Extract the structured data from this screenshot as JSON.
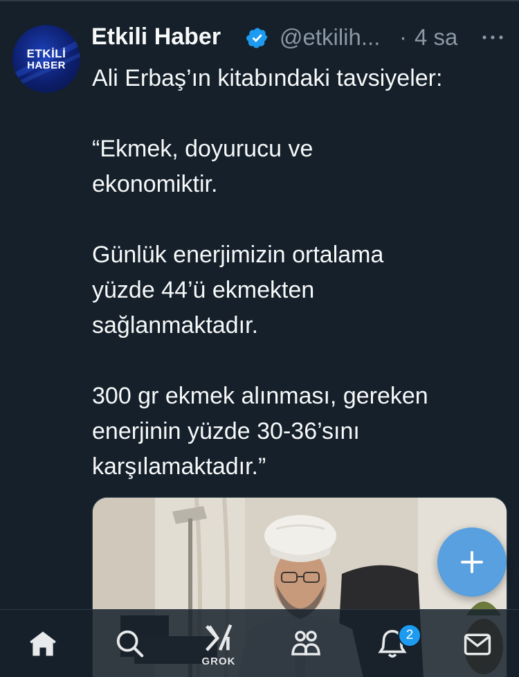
{
  "tweet": {
    "avatar_text_line1": "ETKİLİ",
    "avatar_text_line2": "HABER",
    "display_name": "Etkili Haber",
    "handle": "@etkilih...",
    "separator": "·",
    "time": "4 sa",
    "text": "Ali Erbaş’ın kitabındaki tavsiyeler:\n\n“Ekmek, doyurucu ve\nekonomiktir.\n\nGünlük enerjimizin ortalama\nyüzde 44’ü ekmekten\nsağlanmaktadır.\n\n300 gr ekmek alınması, gereken\nenerjinin yüzde 30-36’sını\nkarşılamaktadır.”"
  },
  "nav": {
    "grok_label": "GROK",
    "notifications_count": "2"
  },
  "colors": {
    "background": "#15202b",
    "verified": "#1d9bf0",
    "secondary_text": "#8b98a5",
    "fab": "#4d9be0"
  },
  "icons": [
    "verified-badge-icon",
    "more-icon",
    "plus-icon",
    "home-icon",
    "search-icon",
    "grok-icon",
    "communities-icon",
    "bell-icon",
    "mail-icon"
  ]
}
